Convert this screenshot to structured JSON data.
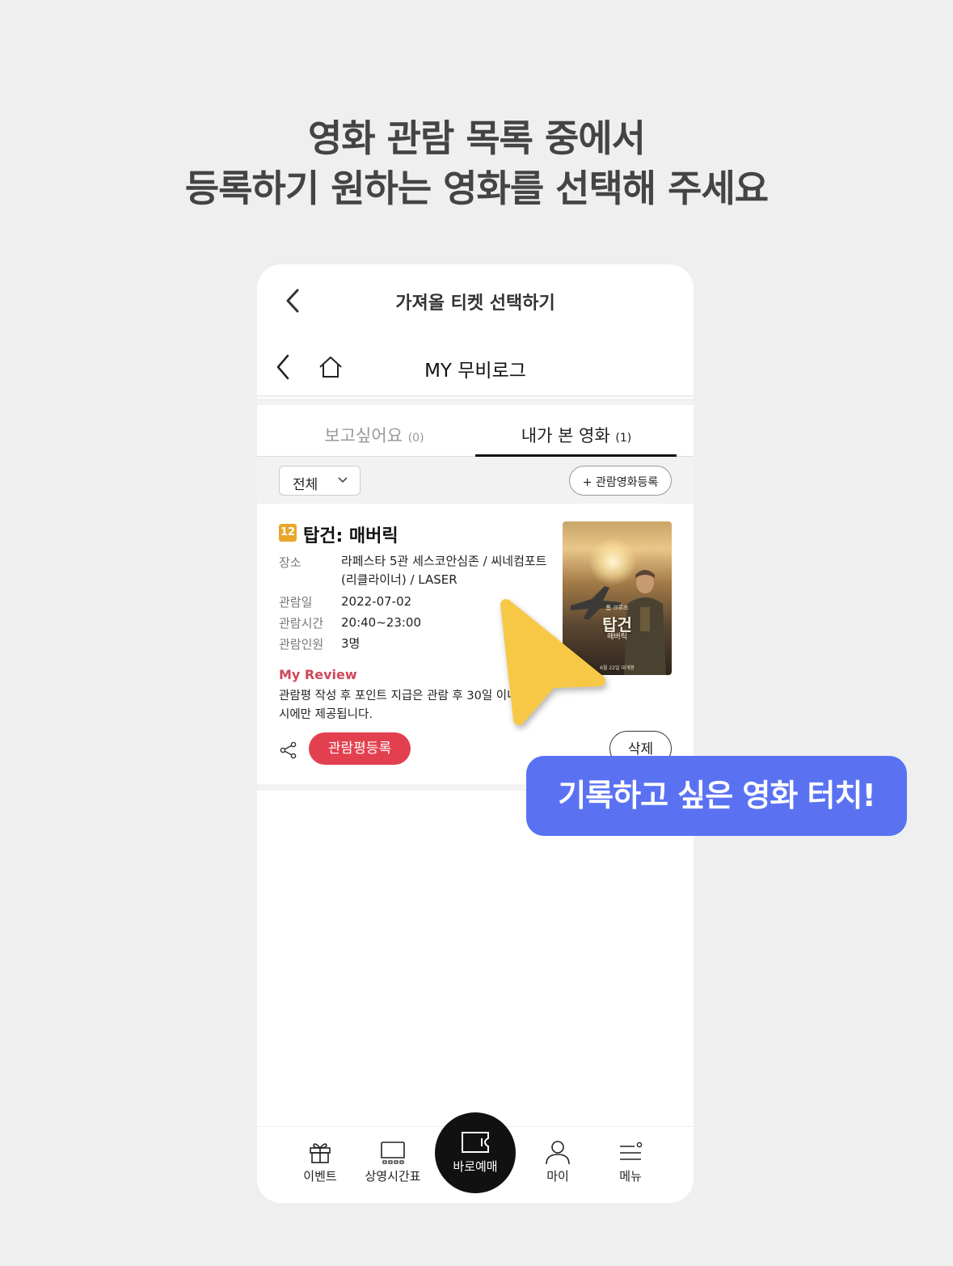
{
  "headline": {
    "line1": "영화 관람 목록 중에서",
    "line2": "등록하기 원하는 영화를 선택해 주세요"
  },
  "topbar": {
    "title": "가져올 티켓 선택하기"
  },
  "navbar": {
    "title": "MY 무비로그"
  },
  "tabs": [
    {
      "label": "보고싶어요",
      "count": "(0)",
      "active": false
    },
    {
      "label": "내가 본 영화",
      "count": "(1)",
      "active": true
    }
  ],
  "filter": {
    "selected": "전체",
    "register_label": "+ 관람영화등록"
  },
  "movie": {
    "rating": "12",
    "rating_color": "#e8a72a",
    "title": "탑건: 매버릭",
    "rows": [
      {
        "label": "장소",
        "value": "라페스타 5관 세스코안심존 / 씨네컴포트 (리클라이너) / LASER"
      },
      {
        "label": "관람일",
        "value": "2022-07-02"
      },
      {
        "label": "관람시간",
        "value": "20:40~23:00"
      },
      {
        "label": "관람인원",
        "value": "3명"
      }
    ],
    "review_heading": "My Review",
    "review_text": "관람평 작성 후 포인트 지급은 관람 후 30일 이내 작성 시에만 제공됩니다.",
    "review_button": "관람평등록",
    "delete_button": "삭제",
    "poster": {
      "subtitle": "톰 크루즈",
      "title": "탑건",
      "title2": "매버릭",
      "date": "6월 22일 대개봉"
    }
  },
  "bottom_nav": [
    {
      "label": "이벤트",
      "icon": "gift-icon"
    },
    {
      "label": "상영시간표",
      "icon": "screen-icon"
    },
    {
      "label": "바로예매",
      "icon": "ticket-icon"
    },
    {
      "label": "마이",
      "icon": "user-icon"
    },
    {
      "label": "메뉴",
      "icon": "menu-icon"
    }
  ],
  "callout": {
    "text": "기록하고 싶은 영화 터치!"
  },
  "colors": {
    "accent_red": "#e3404f",
    "review_pink": "#d0475a",
    "callout_blue": "#5a72f2",
    "cursor_yellow": "#f6c844"
  }
}
